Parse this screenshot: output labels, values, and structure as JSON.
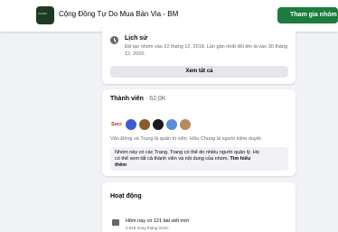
{
  "header": {
    "group_name": "Cộng Đồng Tự Do Mua Bán Via - BM",
    "join_button": "Tham gia nhóm",
    "logo_text": "Via BM"
  },
  "history": {
    "title": "Lịch sử",
    "description": "Đã tạo nhóm vào 22 tháng 12, 2018. Lần gần nhất đổi tên là vào 30 tháng 12, 2020.",
    "see_all": "Xem tất cả"
  },
  "members": {
    "title": "Thành viên",
    "count": "62,0K",
    "avatar_label": "Soci",
    "admins_text": "Văn Đông và Trung là quản trị viên. Hữu Chung là người kiểm duyệt.",
    "note_line1": "Nhóm này có các Trang. Trang có thể do nhiều người quản lý. Họ",
    "note_line2": "có thể xem tất cả thành viên và nội dung của nhóm.",
    "note_link_a": "Tìm hiểu",
    "note_link_b": "thêm"
  },
  "activity": {
    "title": "Hoạt động",
    "posts_today": "Hôm nay có 121 bài viết mới",
    "posts_sub": "2.919 trong tháng trước"
  },
  "colors": {
    "join_button": "#1b7c3d",
    "background": "#f0f2f5",
    "secondary_text": "#65676b"
  }
}
